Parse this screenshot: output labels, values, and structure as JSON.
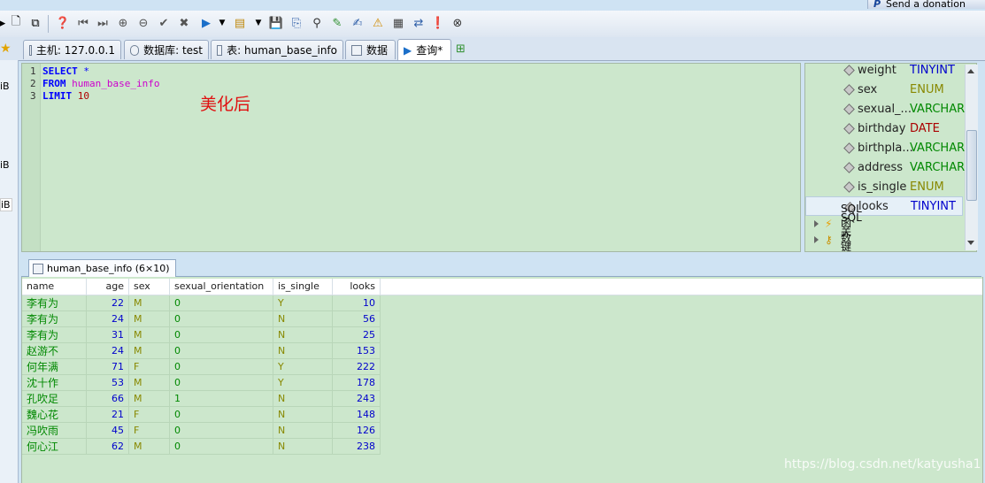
{
  "donation": "Send a donation",
  "tabs": [
    {
      "label": "主机: 127.0.0.1"
    },
    {
      "label": "数据库: test"
    },
    {
      "label": "表: human_base_info"
    },
    {
      "label": "数据"
    },
    {
      "label": "查询*"
    }
  ],
  "left_labels": [
    "iB",
    "iB",
    "iB"
  ],
  "editor": {
    "line_numbers": [
      "1",
      "2",
      "3"
    ],
    "line1": {
      "kw": "SELECT",
      "rest": "*"
    },
    "line2": {
      "kw": "FROM",
      "rest": "human_base_info"
    },
    "line3": {
      "kw": "LIMIT",
      "rest": "10"
    },
    "annotation": "美化后"
  },
  "columns_panel": {
    "columns": [
      {
        "name": "weight",
        "type": "TINYINT",
        "color": "#0000cc"
      },
      {
        "name": "sex",
        "type": "ENUM",
        "color": "#888800"
      },
      {
        "name": "sexual_...",
        "type": "VARCHAR",
        "color": "#008800"
      },
      {
        "name": "birthday",
        "type": "DATE",
        "color": "#aa0000"
      },
      {
        "name": "birthpla...",
        "type": "VARCHAR",
        "color": "#008800"
      },
      {
        "name": "address",
        "type": "VARCHAR",
        "color": "#008800"
      },
      {
        "name": "is_single",
        "type": "ENUM",
        "color": "#888800"
      },
      {
        "name": "looks",
        "type": "TINYINT",
        "color": "#0000cc"
      }
    ],
    "groups": [
      {
        "name": "SQL函数"
      },
      {
        "name": "SQL关键字"
      }
    ]
  },
  "result_tab": {
    "label": "human_base_info (6×10)"
  },
  "result": {
    "headers": [
      "name",
      "age",
      "sex",
      "sexual_orientation",
      "is_single",
      "looks"
    ],
    "rows": [
      [
        "李有为",
        "22",
        "M",
        "0",
        "Y",
        "10"
      ],
      [
        "李有为",
        "24",
        "M",
        "0",
        "N",
        "56"
      ],
      [
        "李有为",
        "31",
        "M",
        "0",
        "N",
        "25"
      ],
      [
        "赵游不",
        "24",
        "M",
        "0",
        "N",
        "153"
      ],
      [
        "何年满",
        "71",
        "F",
        "0",
        "Y",
        "222"
      ],
      [
        "沈十作",
        "53",
        "M",
        "0",
        "Y",
        "178"
      ],
      [
        "孔吹足",
        "66",
        "M",
        "1",
        "N",
        "243"
      ],
      [
        "魏心花",
        "21",
        "F",
        "0",
        "N",
        "148"
      ],
      [
        "冯吹雨",
        "45",
        "F",
        "0",
        "N",
        "126"
      ],
      [
        "何心江",
        "62",
        "M",
        "0",
        "N",
        "238"
      ]
    ]
  },
  "watermark": "https://blog.csdn.net/katyusha1"
}
